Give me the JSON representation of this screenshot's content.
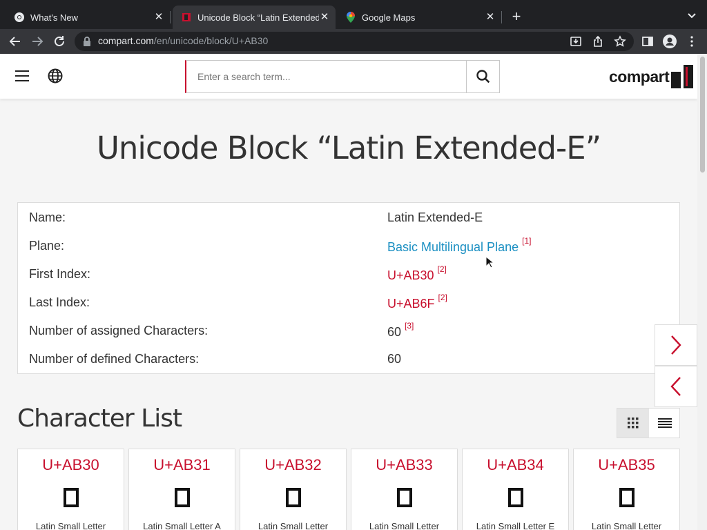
{
  "browser": {
    "tabs": [
      {
        "title": "What's New",
        "icon": "chrome-icon",
        "active": false
      },
      {
        "title": "Unicode Block “Latin Extended-E”",
        "icon": "compart-favicon",
        "active": true
      },
      {
        "title": "Google Maps",
        "icon": "maps-pin-icon",
        "active": false
      }
    ],
    "url_host": "compart.com",
    "url_path": "/en/unicode/block/U+AB30"
  },
  "header": {
    "search_placeholder": "Enter a search term...",
    "logo_text": "compart"
  },
  "page": {
    "title": "Unicode Block “Latin Extended-E”",
    "info": [
      {
        "label": "Name:",
        "value": "Latin Extended-E",
        "ref": ""
      },
      {
        "label": "Plane:",
        "value": "Basic Multilingual Plane",
        "ref": "[1]"
      },
      {
        "label": "First Index:",
        "value": "U+AB30",
        "ref": "[2]"
      },
      {
        "label": "Last Index:",
        "value": "U+AB6F",
        "ref": "[2]"
      },
      {
        "label": "Number of assigned Characters:",
        "value": "60",
        "ref": "[3]"
      },
      {
        "label": "Number of defined Characters:",
        "value": "60",
        "ref": ""
      }
    ],
    "section_title": "Character List",
    "characters": [
      {
        "code": "U+AB30",
        "name": "Latin Small Letter"
      },
      {
        "code": "U+AB31",
        "name": "Latin Small Letter A"
      },
      {
        "code": "U+AB32",
        "name": "Latin Small Letter"
      },
      {
        "code": "U+AB33",
        "name": "Latin Small Letter"
      },
      {
        "code": "U+AB34",
        "name": "Latin Small Letter E"
      },
      {
        "code": "U+AB35",
        "name": "Latin Small Letter"
      }
    ]
  },
  "colors": {
    "accent": "#c8102e",
    "link": "#1a8fc2"
  }
}
